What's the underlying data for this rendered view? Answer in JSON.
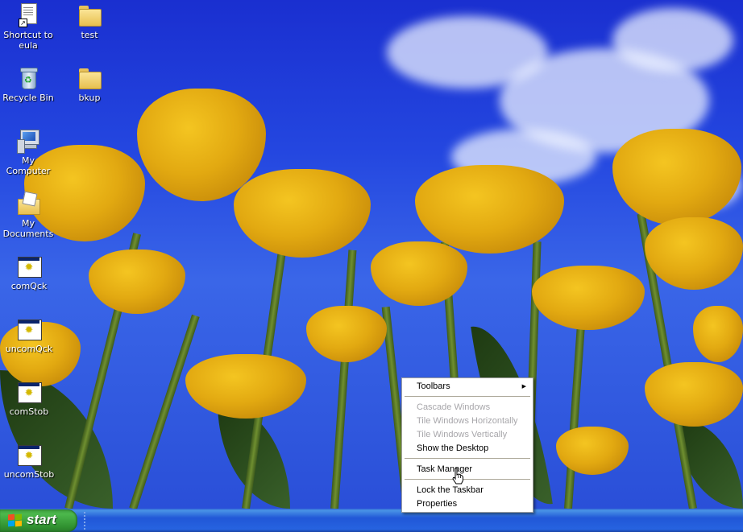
{
  "desktop": {
    "icons": [
      {
        "label": "Shortcut to eula",
        "icon": "document-shortcut-icon"
      },
      {
        "label": "test",
        "icon": "folder-icon"
      },
      {
        "label": "Recycle Bin",
        "icon": "recycle-bin-icon"
      },
      {
        "label": "bkup",
        "icon": "folder-icon"
      },
      {
        "label": "My Computer",
        "icon": "computer-icon"
      },
      {
        "label": "My Documents",
        "icon": "my-documents-icon"
      },
      {
        "label": "comQck",
        "icon": "executable-icon"
      },
      {
        "label": "uncomQck",
        "icon": "executable-icon"
      },
      {
        "label": "comStob",
        "icon": "executable-icon"
      },
      {
        "label": "uncomStob",
        "icon": "executable-icon"
      }
    ]
  },
  "context_menu": {
    "toolbars": "Toolbars",
    "cascade": "Cascade Windows",
    "tile_h": "Tile Windows Horizontally",
    "tile_v": "Tile Windows Vertically",
    "show_desktop": "Show the Desktop",
    "task_manager": "Task Manager",
    "lock_taskbar": "Lock the Taskbar",
    "properties": "Properties",
    "submenu_arrow": "▶"
  },
  "taskbar": {
    "start_label": "start"
  },
  "colors": {
    "taskbar_blue": "#2157d7",
    "start_green": "#3c9c3c",
    "disabled_text": "#a7a6aa"
  }
}
